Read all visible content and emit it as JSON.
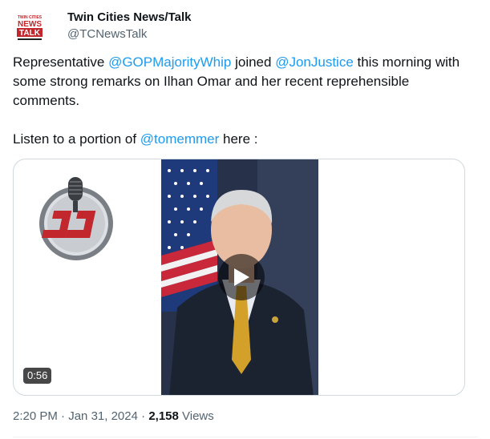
{
  "author": {
    "display_name": "Twin Cities News/Talk",
    "handle": "@TCNewsTalk",
    "avatar_icon": "twin-cities-news-talk-logo",
    "avatar_text": [
      "TWIN CITIES",
      "NEWS",
      "TALK"
    ]
  },
  "tweet": {
    "line1_part1": "Representative ",
    "mention1": "@GOPMajorityWhip",
    "line1_part2": " joined ",
    "mention2": "@JonJustice",
    "line1_part3": " this morning with some strong remarks on Ilhan Omar and her recent reprehensible comments.",
    "line2_part1": "Listen to a portion of ",
    "mention3": "@tomemmer",
    "line2_part2": " here :"
  },
  "media": {
    "duration": "0:56",
    "play_icon": "play-icon",
    "radio_logo_icon": "microphone-logo-icon"
  },
  "meta": {
    "time": "2:20 PM",
    "separator1": " · ",
    "date": "Jan 31, 2024",
    "separator2": " · ",
    "views_count": "2,158",
    "views_label": " Views"
  },
  "colors": {
    "link": "#1d9bf0",
    "secondary_text": "#536471",
    "primary_text": "#0f1419",
    "border": "#cfd9de"
  }
}
